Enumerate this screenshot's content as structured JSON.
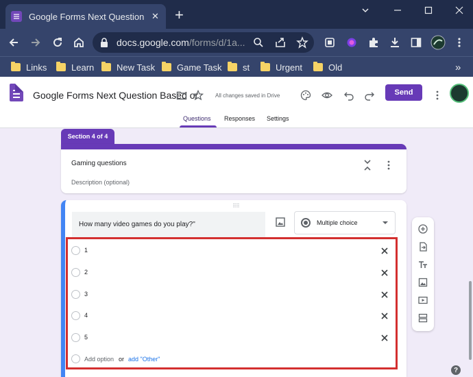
{
  "browser": {
    "tab_title": "Google Forms Next Question Based o",
    "tab_close": "✕",
    "new_tab": "+",
    "url_host": "docs.google.com",
    "url_path": "/forms/d/1a...",
    "bookmarks": [
      "Links",
      "Learn",
      "New Task",
      "Game Task",
      "st",
      "Urgent",
      "Old"
    ],
    "bookmarks_more": "»",
    "icons": [
      "back-icon",
      "forward-icon",
      "reload-icon",
      "home-icon",
      "lock-icon",
      "zoom-icon",
      "share-icon",
      "star-icon",
      "screenshot-icon",
      "extension-icon",
      "puzzle-icon",
      "download-icon",
      "sidebar-icon",
      "profile-icon",
      "menu-icon"
    ]
  },
  "forms": {
    "doc_title": "Google Forms Next Question Based or",
    "saved_status": "All changes saved in Drive",
    "send_label": "Send",
    "tabs": [
      "Questions",
      "Responses",
      "Settings"
    ],
    "active_tab": "Questions",
    "accent_color": "#673ab7"
  },
  "section": {
    "tag": "Section 4 of 4",
    "title": "Gaming questions",
    "description_placeholder": "Description (optional)"
  },
  "question": {
    "text": "How many video games do you play?\"",
    "type": "Multiple choice",
    "options": [
      "1",
      "2",
      "3",
      "4",
      "5"
    ],
    "add_option": "Add option",
    "or": "or",
    "add_other": "add \"Other\""
  },
  "side_toolbar": [
    "add-question-icon",
    "import-questions-icon",
    "add-title-icon",
    "add-image-icon",
    "add-video-icon",
    "add-section-icon"
  ],
  "help": "?"
}
